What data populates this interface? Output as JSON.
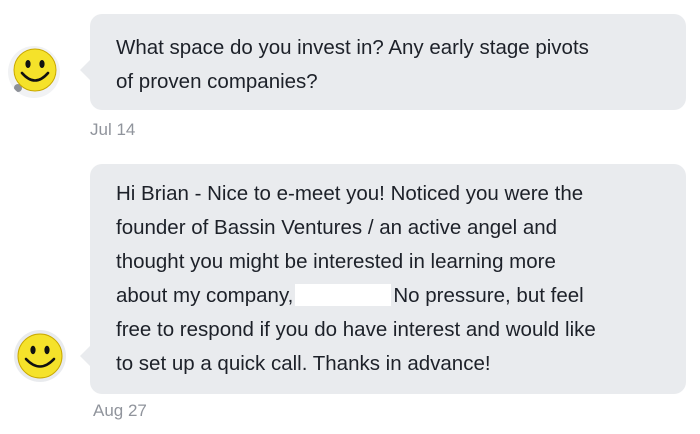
{
  "messages": [
    {
      "avatar_icon": "smiley-face-icon",
      "lines": [
        "What space do you invest in? Any early stage pivots",
        "of proven companies?"
      ],
      "timestamp": "Jul 14"
    },
    {
      "avatar_icon": "smiley-face-icon",
      "lines": [
        "Hi Brian - Nice to e-meet you! Noticed you were the",
        "founder of Bassin Ventures / an active angel and",
        "thought you might be interested in learning more"
      ],
      "line4_before": "about my company,",
      "line4_after": "No pressure, but feel",
      "lines_end": [
        "free to respond if you do have interest and would like",
        "to set up a quick call. Thanks in advance!"
      ],
      "timestamp": "Aug 27"
    }
  ],
  "colors": {
    "bubble_background": "#e9ebee",
    "message_text": "#1d2129",
    "timestamp_text": "#90949c",
    "smiley_yellow": "#f5e22a"
  }
}
